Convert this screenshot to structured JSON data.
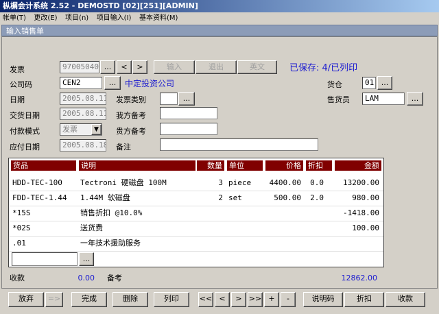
{
  "window": {
    "title": "枞榍会计系统 2.52 - DEMOSTD [02][251][ADMIN]"
  },
  "menu": [
    "帐单(T)",
    "更改(E)",
    "项目(n)",
    "项目输入(I)",
    "基本资料(M)"
  ],
  "panel_title": "输入销售单",
  "form": {
    "invoice_label": "发票",
    "invoice_value": "97005040",
    "company_label": "公司码",
    "company_value": "CEN2",
    "company_name": "中定投资公司",
    "date_label": "日期",
    "date_value": "2005.08.11",
    "invoice_type_label": "发票类别",
    "invoice_type_value": "",
    "trade_date_label": "交货日期",
    "trade_date_value": "2005.08.11",
    "our_ref_label": "我方备考",
    "our_ref_value": "",
    "pay_mode_label": "付款模式",
    "pay_mode_value": "发票",
    "your_ref_label": "贵方备考",
    "your_ref_value": "",
    "due_date_label": "应付日期",
    "due_date_value": "2005.08.18",
    "remark_label": "备注",
    "remark_value": "",
    "warehouse_label": "货仓",
    "warehouse_value": "01",
    "salesman_label": "售货员",
    "salesman_value": "LAM",
    "status": "已保存: 4/已列印",
    "btn_dots": "...",
    "btn_prev": "<",
    "btn_next": ">",
    "btn_input": "输入",
    "btn_exit": "退出",
    "btn_english": "英文"
  },
  "table": {
    "headers": [
      "货品",
      "说明",
      "数量",
      "单位",
      "价格",
      "折扣",
      "金额"
    ],
    "rows": [
      {
        "item": "HDD-TEC-100",
        "desc": "Tectroni 硬磁盘 100M",
        "qty": "3",
        "unit": "piece",
        "price": "4400.00",
        "disc": "0.0",
        "amount": "13200.00"
      },
      {
        "item": "FDD-TEC-1.44",
        "desc": "1.44M 软磁盘",
        "qty": "2",
        "unit": "set",
        "price": "500.00",
        "disc": "2.0",
        "amount": "980.00"
      },
      {
        "item": "*15S",
        "desc": "销售折扣 @10.0%",
        "qty": "",
        "unit": "",
        "price": "",
        "disc": "",
        "amount": "-1418.00"
      },
      {
        "item": "*02S",
        "desc": "送货费",
        "qty": "",
        "unit": "",
        "price": "",
        "disc": "",
        "amount": "100.00"
      },
      {
        "item": ".01",
        "desc": "一年技术援助服务",
        "qty": "",
        "unit": "",
        "price": "",
        "disc": "",
        "amount": ""
      }
    ],
    "new_dots": "..."
  },
  "footer": {
    "received_label": "收款",
    "received_value": "0.00",
    "ref_label": "备考",
    "total": "12862.00"
  },
  "buttons": {
    "abandon": "放弃",
    "arrow": "=>",
    "done": "完成",
    "delete": "删除",
    "print": "列印",
    "first": "<<",
    "prev": "<",
    "next": ">",
    "last": ">>",
    "add": "+",
    "remove": "-",
    "description": "说明码",
    "discount": "折扣",
    "receive": "收款"
  }
}
